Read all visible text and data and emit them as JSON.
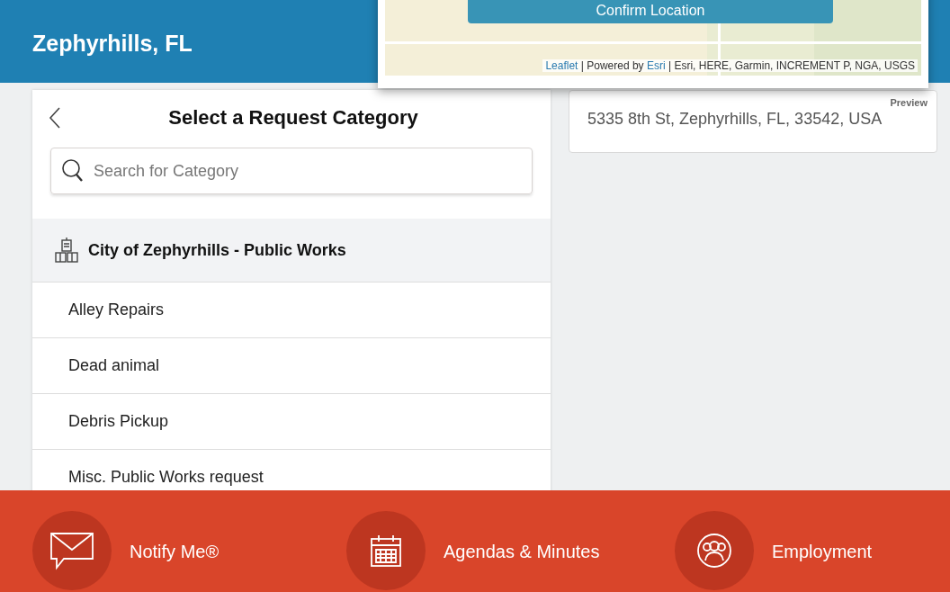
{
  "header": {
    "title": "Zephyrhills, FL"
  },
  "map_popup": {
    "button": "Confirm Location",
    "attribution": [
      {
        "kind": "link",
        "text": "Leaflet"
      },
      {
        "kind": "text",
        "text": " | Powered by "
      },
      {
        "kind": "link",
        "text": "Esri"
      },
      {
        "kind": "text",
        "text": " | Esri, HERE, Garmin, INCREMENT P, NGA, USGS"
      }
    ]
  },
  "category_panel": {
    "title": "Select a Request Category",
    "search": {
      "placeholder": "Search for Category"
    },
    "group": {
      "name": "City of Zephyrhills - Public Works",
      "items": [
        {
          "label": "Alley Repairs"
        },
        {
          "label": "Dead animal"
        },
        {
          "label": "Debris Pickup"
        },
        {
          "label": "Misc. Public Works request"
        }
      ]
    }
  },
  "preview": {
    "label": "Preview",
    "address": "5335 8th St, Zephyrhills, FL, 33542, USA"
  },
  "footer": {
    "links": [
      {
        "kind": "mail",
        "label": "Notify Me®"
      },
      {
        "kind": "calendar",
        "label": "Agendas & Minutes"
      },
      {
        "kind": "people",
        "label": "Employment"
      }
    ]
  }
}
